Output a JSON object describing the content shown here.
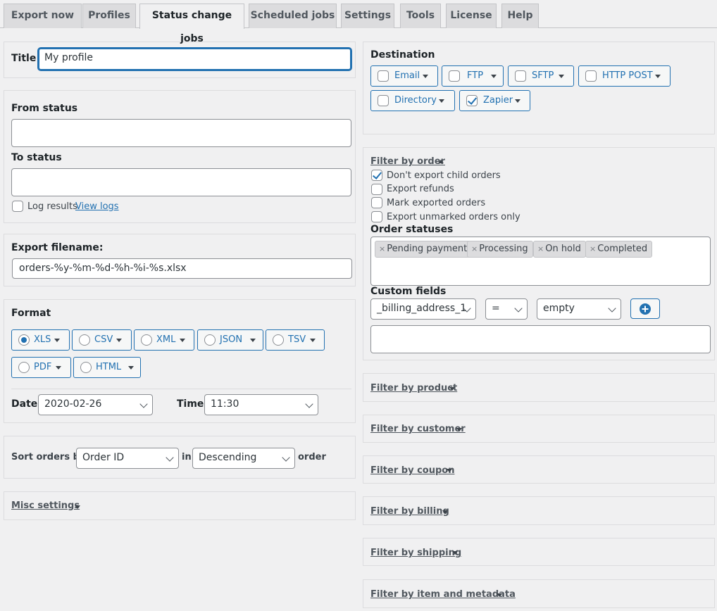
{
  "tabs": [
    {
      "label": "Export now"
    },
    {
      "label": "Profiles"
    },
    {
      "label": "Status change jobs"
    },
    {
      "label": "Scheduled jobs"
    },
    {
      "label": "Settings"
    },
    {
      "label": "Tools"
    },
    {
      "label": "License"
    },
    {
      "label": "Help"
    }
  ],
  "active_tab": "Status change jobs",
  "title": {
    "label": "Title",
    "value": "My profile"
  },
  "status": {
    "from_label": "From status",
    "from_value": "",
    "to_label": "To status",
    "to_value": "",
    "log_label": "Log results",
    "log_checked": false,
    "view_logs_label": "View logs"
  },
  "filename": {
    "label": "Export filename:",
    "value": "orders-%y-%m-%d-%h-%i-%s.xlsx"
  },
  "format": {
    "label": "Format",
    "options": [
      {
        "label": "XLS",
        "checked": true
      },
      {
        "label": "CSV",
        "checked": false
      },
      {
        "label": "XML",
        "checked": false
      },
      {
        "label": "JSON",
        "checked": false
      },
      {
        "label": "TSV",
        "checked": false
      },
      {
        "label": "PDF",
        "checked": false
      },
      {
        "label": "HTML",
        "checked": false
      }
    ],
    "date_label": "Date",
    "date_value": "2020-02-26",
    "time_label": "Time",
    "time_value": "11:30"
  },
  "sort": {
    "label": "Sort orders by",
    "field_value": "Order ID",
    "in_label": "in",
    "direction_value": "Descending",
    "suffix": "order"
  },
  "misc": {
    "label": "Misc settings"
  },
  "destination": {
    "label": "Destination",
    "options": [
      {
        "label": "Email",
        "checked": false
      },
      {
        "label": "FTP",
        "checked": false
      },
      {
        "label": "SFTP",
        "checked": false
      },
      {
        "label": "HTTP POST",
        "checked": false
      },
      {
        "label": "Directory",
        "checked": false
      },
      {
        "label": "Zapier",
        "checked": true
      }
    ]
  },
  "filter_order": {
    "label": "Filter by order",
    "checks": [
      {
        "label": "Don't export child orders",
        "checked": true
      },
      {
        "label": "Export refunds",
        "checked": false
      },
      {
        "label": "Mark exported orders",
        "checked": false
      },
      {
        "label": "Export unmarked orders only",
        "checked": false
      }
    ],
    "statuses_label": "Order statuses",
    "statuses": [
      "Pending payment",
      "Processing",
      "On hold",
      "Completed"
    ],
    "custom_fields_label": "Custom fields",
    "cf_field": "_billing_address_1",
    "cf_operator": "=",
    "cf_value": "empty",
    "cf_text": ""
  },
  "filters": [
    {
      "label": "Filter by product"
    },
    {
      "label": "Filter by customer"
    },
    {
      "label": "Filter by coupon"
    },
    {
      "label": "Filter by billing"
    },
    {
      "label": "Filter by shipping"
    },
    {
      "label": "Filter by item and metadata"
    }
  ],
  "colors": {
    "accent": "#2271b1",
    "background": "#f0f0f1",
    "tab_inactive": "#dcdcde"
  }
}
